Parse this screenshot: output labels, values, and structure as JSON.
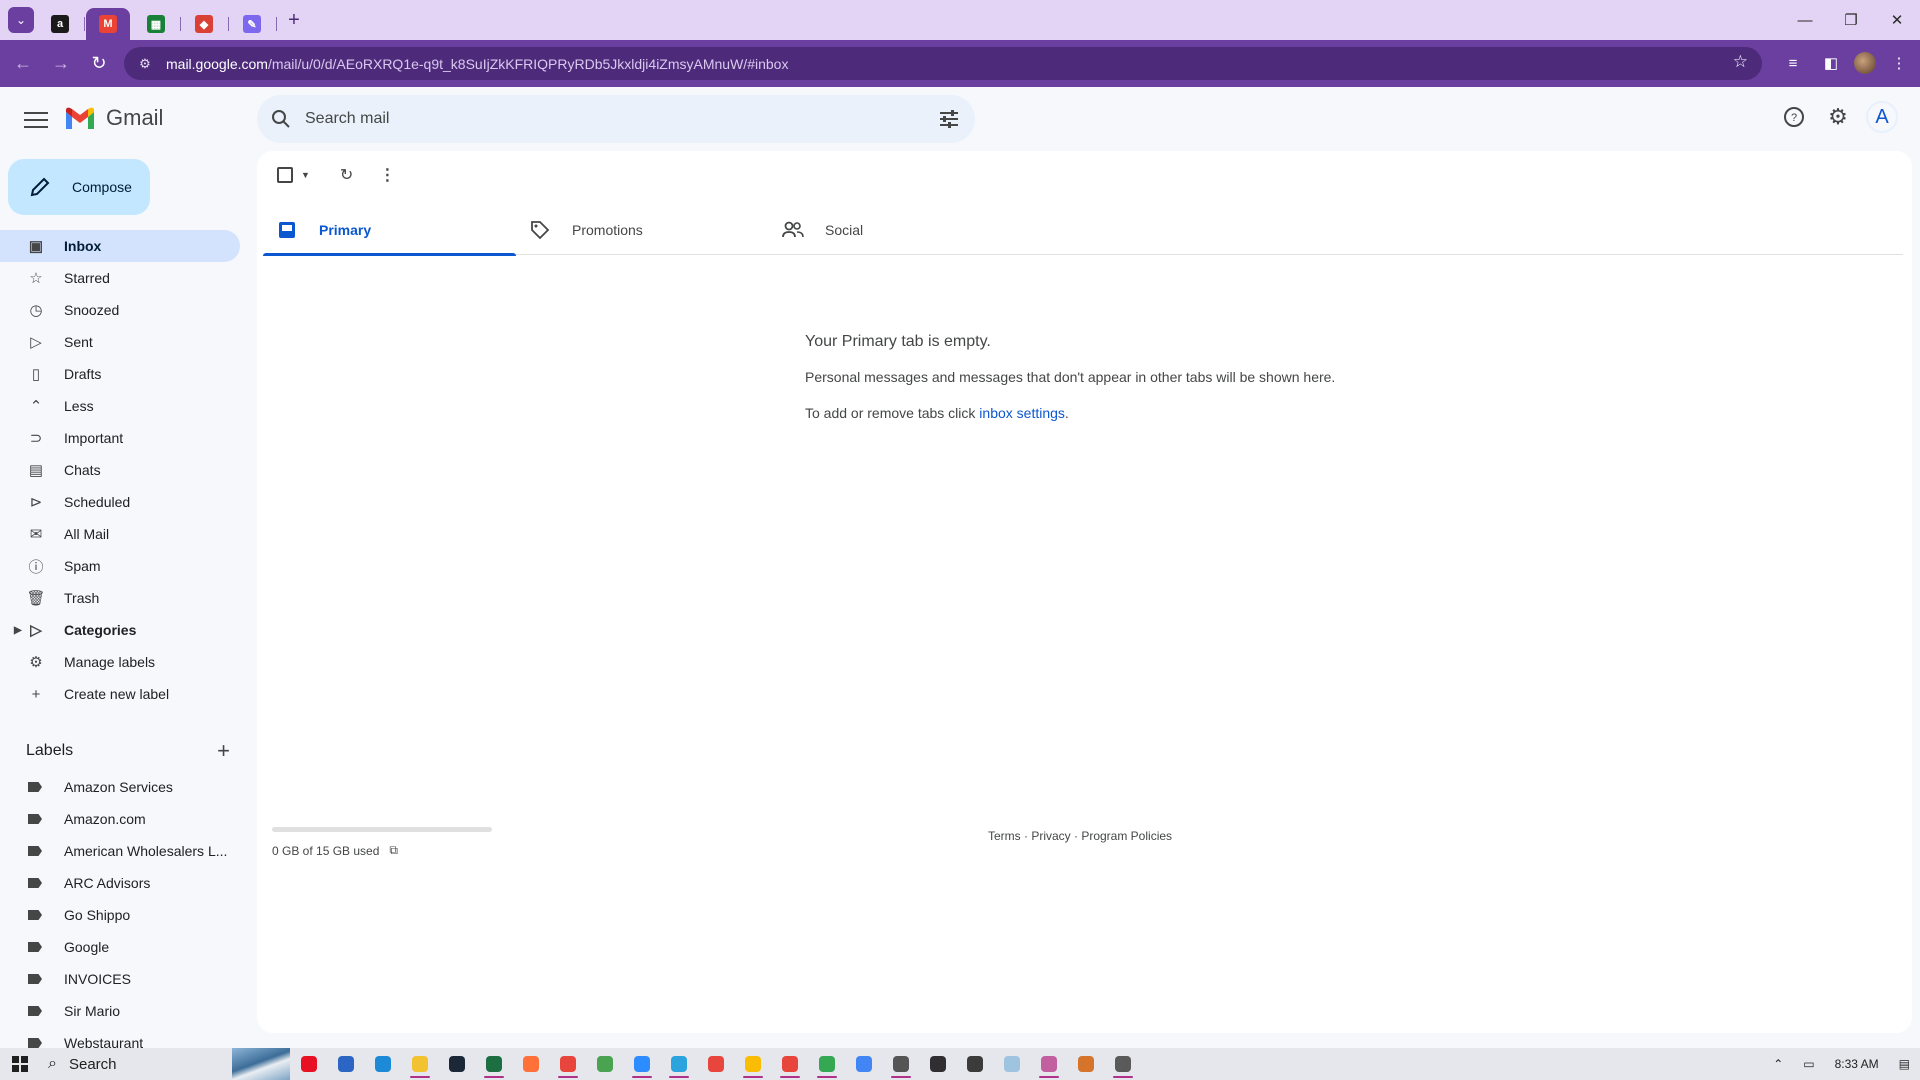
{
  "browser": {
    "tabs": [
      {
        "name": "amazon",
        "letter": "a",
        "color": "#1a1a1a",
        "active": false
      },
      {
        "name": "gmail",
        "letter": "M",
        "color": "#ea4335",
        "active": true
      },
      {
        "name": "sheets",
        "letter": "▦",
        "color": "#188038",
        "active": false
      },
      {
        "name": "todoist",
        "letter": "◆",
        "color": "#db4035",
        "active": false
      },
      {
        "name": "clickup",
        "letter": "✎",
        "color": "#7b68ee",
        "active": false
      }
    ],
    "url_host": "mail.google.com",
    "url_path": "/mail/u/0/d/AEoRXRQ1e-q9t_k8SuIjZkKFRIQPRyRDb5Jkxldji4iZmsyAMnuW/#inbox"
  },
  "gmail": {
    "logo_text": "Gmail",
    "search_placeholder": "Search mail",
    "avatar_letter": "A",
    "compose_label": "Compose",
    "nav": [
      {
        "label": "Inbox",
        "icon": "inbox-icon",
        "glyph": "▣",
        "active": true
      },
      {
        "label": "Starred",
        "icon": "star-icon",
        "glyph": "☆"
      },
      {
        "label": "Snoozed",
        "icon": "clock-icon",
        "glyph": "◷"
      },
      {
        "label": "Sent",
        "icon": "send-icon",
        "glyph": "▷"
      },
      {
        "label": "Drafts",
        "icon": "draft-icon",
        "glyph": "▯"
      },
      {
        "label": "Less",
        "icon": "chevron-up-icon",
        "glyph": "⌃"
      },
      {
        "label": "Important",
        "icon": "important-icon",
        "glyph": "⊃"
      },
      {
        "label": "Chats",
        "icon": "chat-icon",
        "glyph": "▤"
      },
      {
        "label": "Scheduled",
        "icon": "scheduled-icon",
        "glyph": "⊳"
      },
      {
        "label": "All Mail",
        "icon": "all-mail-icon",
        "glyph": "✉"
      },
      {
        "label": "Spam",
        "icon": "spam-icon",
        "glyph": "ⓘ"
      },
      {
        "label": "Trash",
        "icon": "trash-icon",
        "glyph": "🗑"
      },
      {
        "label": "Categories",
        "icon": "label-icon",
        "glyph": "▷",
        "bold": true,
        "caret": true
      },
      {
        "label": "Manage labels",
        "icon": "gear-icon",
        "glyph": "⚙"
      },
      {
        "label": "Create new label",
        "icon": "plus-icon",
        "glyph": "+"
      }
    ],
    "labels_title": "Labels",
    "labels": [
      "Amazon Services",
      "Amazon.com",
      "American Wholesalers L...",
      "ARC Advisors",
      "Go Shippo",
      "Google",
      "INVOICES",
      "Sir Mario",
      "Webstaurant"
    ],
    "tabs": [
      {
        "label": "Primary",
        "icon": "inbox-tab-icon",
        "active": true
      },
      {
        "label": "Promotions",
        "icon": "tag-icon",
        "active": false
      },
      {
        "label": "Social",
        "icon": "people-icon",
        "active": false
      }
    ],
    "empty_title": "Your Primary tab is empty.",
    "empty_desc": "Personal messages and messages that don't appear in other tabs will be shown here.",
    "empty_hint_prefix": "To add or remove tabs click ",
    "empty_hint_link": "inbox settings",
    "empty_hint_suffix": ".",
    "storage_text": "0 GB of 15 GB used",
    "storage_fraction": 0.0,
    "footer": "Terms · Privacy · Program Policies"
  },
  "taskbar": {
    "search_label": "Search",
    "time": "8:33 AM",
    "apps": [
      {
        "name": "app-red",
        "color": "#e81123",
        "open": false
      },
      {
        "name": "app-store",
        "color": "#2b66c4",
        "open": false
      },
      {
        "name": "edge",
        "color": "#1c8ad6",
        "open": false
      },
      {
        "name": "file-explorer",
        "color": "#f2c230",
        "open": true
      },
      {
        "name": "steam",
        "color": "#1b2838",
        "open": false
      },
      {
        "name": "excel",
        "color": "#1d6f42",
        "open": true
      },
      {
        "name": "firefox",
        "color": "#ff7139",
        "open": false
      },
      {
        "name": "chrome-1",
        "color": "#e8453c",
        "open": true
      },
      {
        "name": "chrome-2",
        "color": "#4aa351",
        "open": false
      },
      {
        "name": "zoom",
        "color": "#2d8cff",
        "open": true
      },
      {
        "name": "telegram",
        "color": "#2aa3df",
        "open": true
      },
      {
        "name": "chrome-3",
        "color": "#e8453c",
        "open": false
      },
      {
        "name": "chrome-4",
        "color": "#fbbc05",
        "open": true
      },
      {
        "name": "chrome-5",
        "color": "#e8453c",
        "open": true
      },
      {
        "name": "chrome-6",
        "color": "#34a853",
        "open": true
      },
      {
        "name": "chrome-7",
        "color": "#4285f4",
        "open": false
      },
      {
        "name": "calculator",
        "color": "#555555",
        "open": true
      },
      {
        "name": "obs",
        "color": "#302e31",
        "open": false
      },
      {
        "name": "notes",
        "color": "#3b3b3b",
        "open": false
      },
      {
        "name": "files",
        "color": "#9ec4e0",
        "open": false
      },
      {
        "name": "paint",
        "color": "#c25f9e",
        "open": true
      },
      {
        "name": "app-misc",
        "color": "#d6742b",
        "open": false
      },
      {
        "name": "settings",
        "color": "#5a5a5a",
        "open": true
      }
    ]
  }
}
